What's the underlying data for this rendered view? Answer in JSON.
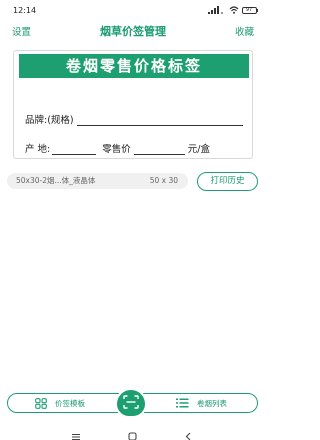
{
  "status_bar": {
    "time": "12:14",
    "battery": "97"
  },
  "header": {
    "left_label": "设置",
    "title": "烟草价签管理",
    "right_label": "收藏"
  },
  "label": {
    "heading": "卷烟零售价格标签",
    "brand_label": "品牌:(规格)",
    "origin_label": "产 地:",
    "price_label": "零售价",
    "unit_label": "元/盒"
  },
  "template": {
    "name": "50x30-2烟...体_液晶体",
    "size": "50 x 30",
    "history_label": "打印历史"
  },
  "bottom_nav": {
    "left_label": "价签模板",
    "right_label": "卷烟列表"
  },
  "colors": {
    "accent": "#1d9f72"
  }
}
